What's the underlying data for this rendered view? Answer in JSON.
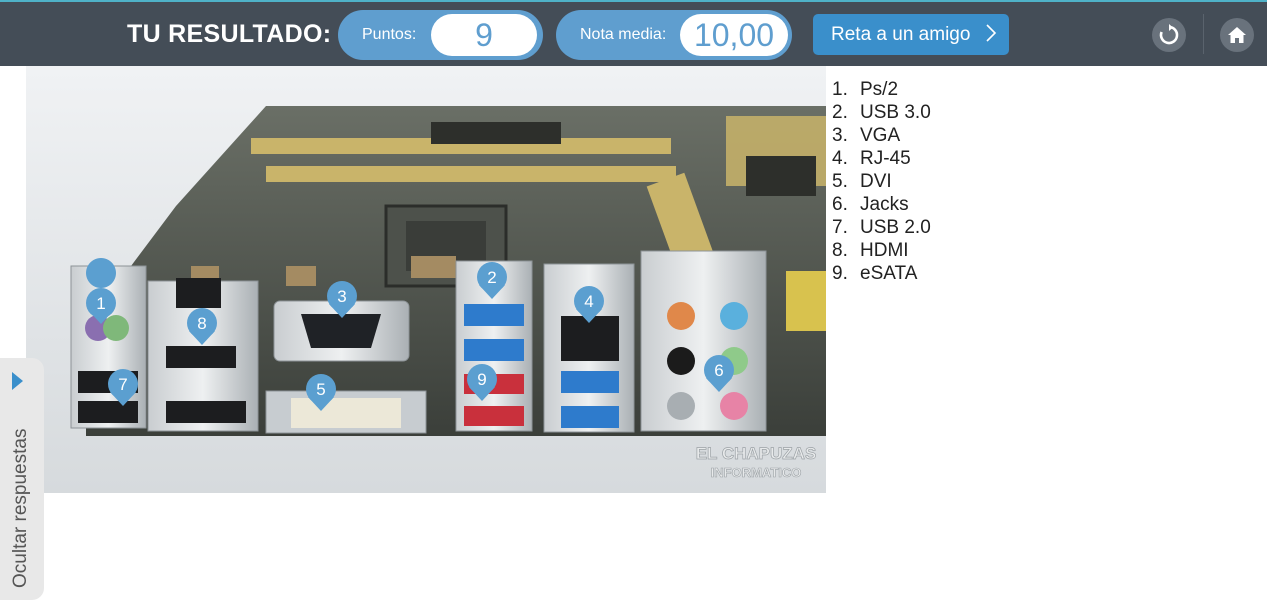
{
  "header": {
    "title": "TU RESULTADO:",
    "points_label": "Puntos:",
    "points_value": "9",
    "grade_label": "Nota media:",
    "grade_value": "10,00",
    "challenge_label": "Reta a un amigo",
    "restart_icon": "restart-icon",
    "home_icon": "home-icon"
  },
  "colors": {
    "topbar": "#444d57",
    "accent": "#3a8fcb",
    "pill": "#5f9ecf",
    "marker": "#5b9fd0"
  },
  "photo": {
    "watermark_line1": "EL CHAPUZAS",
    "watermark_line2": "INFORMATICO",
    "markers": [
      "1",
      "2",
      "3",
      "4",
      "5",
      "6",
      "7",
      "8",
      "9"
    ]
  },
  "answers": [
    {
      "num": "1.",
      "label": "Ps/2"
    },
    {
      "num": "2.",
      "label": "USB 3.0"
    },
    {
      "num": "3.",
      "label": "VGA"
    },
    {
      "num": "4.",
      "label": "RJ-45"
    },
    {
      "num": "5.",
      "label": "DVI"
    },
    {
      "num": "6.",
      "label": "Jacks"
    },
    {
      "num": "7.",
      "label": "USB 2.0"
    },
    {
      "num": "8.",
      "label": "HDMI"
    },
    {
      "num": "9.",
      "label": "eSATA"
    }
  ],
  "sidebar": {
    "toggle_label": "Ocultar respuestas"
  }
}
